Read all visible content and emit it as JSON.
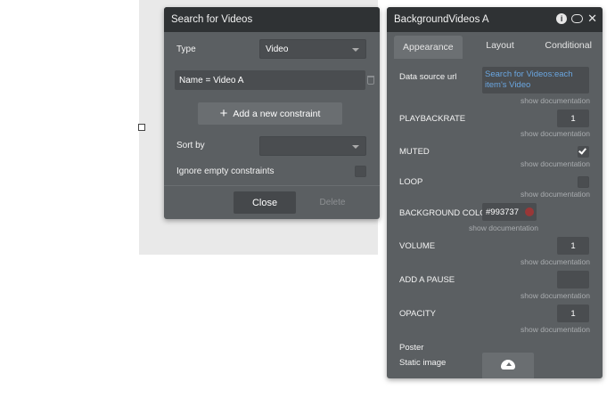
{
  "search_panel": {
    "title": "Search for Videos",
    "type_label": "Type",
    "type_value": "Video",
    "constraint": "Name =  Video A",
    "add_constraint_label": "Add a new constraint",
    "sort_by_label": "Sort by",
    "sort_by_value": "",
    "ignore_empty_label": "Ignore empty constraints",
    "close_label": "Close",
    "delete_label": "Delete"
  },
  "props_panel": {
    "title": "BackgroundVideos A",
    "tabs": [
      {
        "label": "Appearance",
        "active": true
      },
      {
        "label": "Layout",
        "active": false
      },
      {
        "label": "Conditional",
        "active": false
      }
    ],
    "show_doc": "show documentation",
    "data_source_label": "Data source url",
    "data_source_value": "Search for Videos:each item's Video",
    "playbackrate_label": "PLAYBACKRATE",
    "playbackrate_value": "1",
    "muted_label": "MUTED",
    "muted_checked": true,
    "loop_label": "LOOP",
    "loop_checked": false,
    "bg_color_label": "BACKGROUND COLO",
    "bg_color_value": "#993737",
    "volume_label": "VOLUME",
    "volume_value": "1",
    "add_pause_label": "ADD A PAUSE",
    "add_pause_value": "",
    "opacity_label": "OPACITY",
    "opacity_value": "1",
    "poster_label": "Poster",
    "static_image_label": "Static image"
  },
  "icons": [
    "info-icon",
    "comment-icon",
    "close-icon",
    "plus-icon",
    "trash-icon",
    "chevron-down-icon",
    "checkmark-icon",
    "upload-icon"
  ]
}
